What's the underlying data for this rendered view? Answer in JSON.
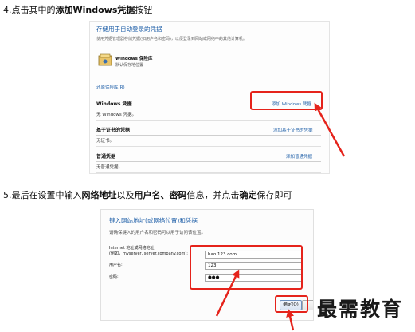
{
  "step4": {
    "prefix": "4.点击其中的",
    "bold": "添加Windows凭据",
    "suffix": "按钮"
  },
  "panel1": {
    "title": "存储用于自动登录的凭据",
    "description": "使用凭据管理器存储凭据(如用户名和密码)，以便登录到网站或网络中的其他计算机。",
    "vault_name": "Windows 保险库",
    "vault_sub": "默认保存地位置",
    "link_small": "还原保险库(R)",
    "sections": [
      {
        "heading": "Windows 凭据",
        "action": "添加 Windows 凭据",
        "body": "无 Windows 凭据。"
      },
      {
        "heading": "基于证书的凭据",
        "action": "添加基于证书的凭据",
        "body": "无证书。"
      },
      {
        "heading": "普通凭据",
        "action": "添加普通凭据",
        "body": "无普通凭据。"
      }
    ]
  },
  "step5": {
    "p1": "5.最后在设置中输入",
    "b1": "网络地址",
    "p2": "以及",
    "b2": "用户名、密码",
    "p3": "信息，并点击",
    "b3": "确定",
    "p4": "保存即可"
  },
  "panel2": {
    "title": "键入网站地址(或网络位置)和凭据",
    "description": "请确保键入的用户名和密码可以用于访问该位置。",
    "address_label_1": "Internet 地址或网络地址",
    "address_label_2": "(例如，myserver, server.company.com):",
    "address_value": "hao 123.com",
    "username_label": "用户名:",
    "username_value": "123",
    "password_label": "密码:",
    "password_value": "●●●",
    "ok_label": "确定(O)"
  },
  "watermark": "最需教育",
  "colors": {
    "annotation": "#e5231b",
    "link": "#1f5fa8"
  }
}
